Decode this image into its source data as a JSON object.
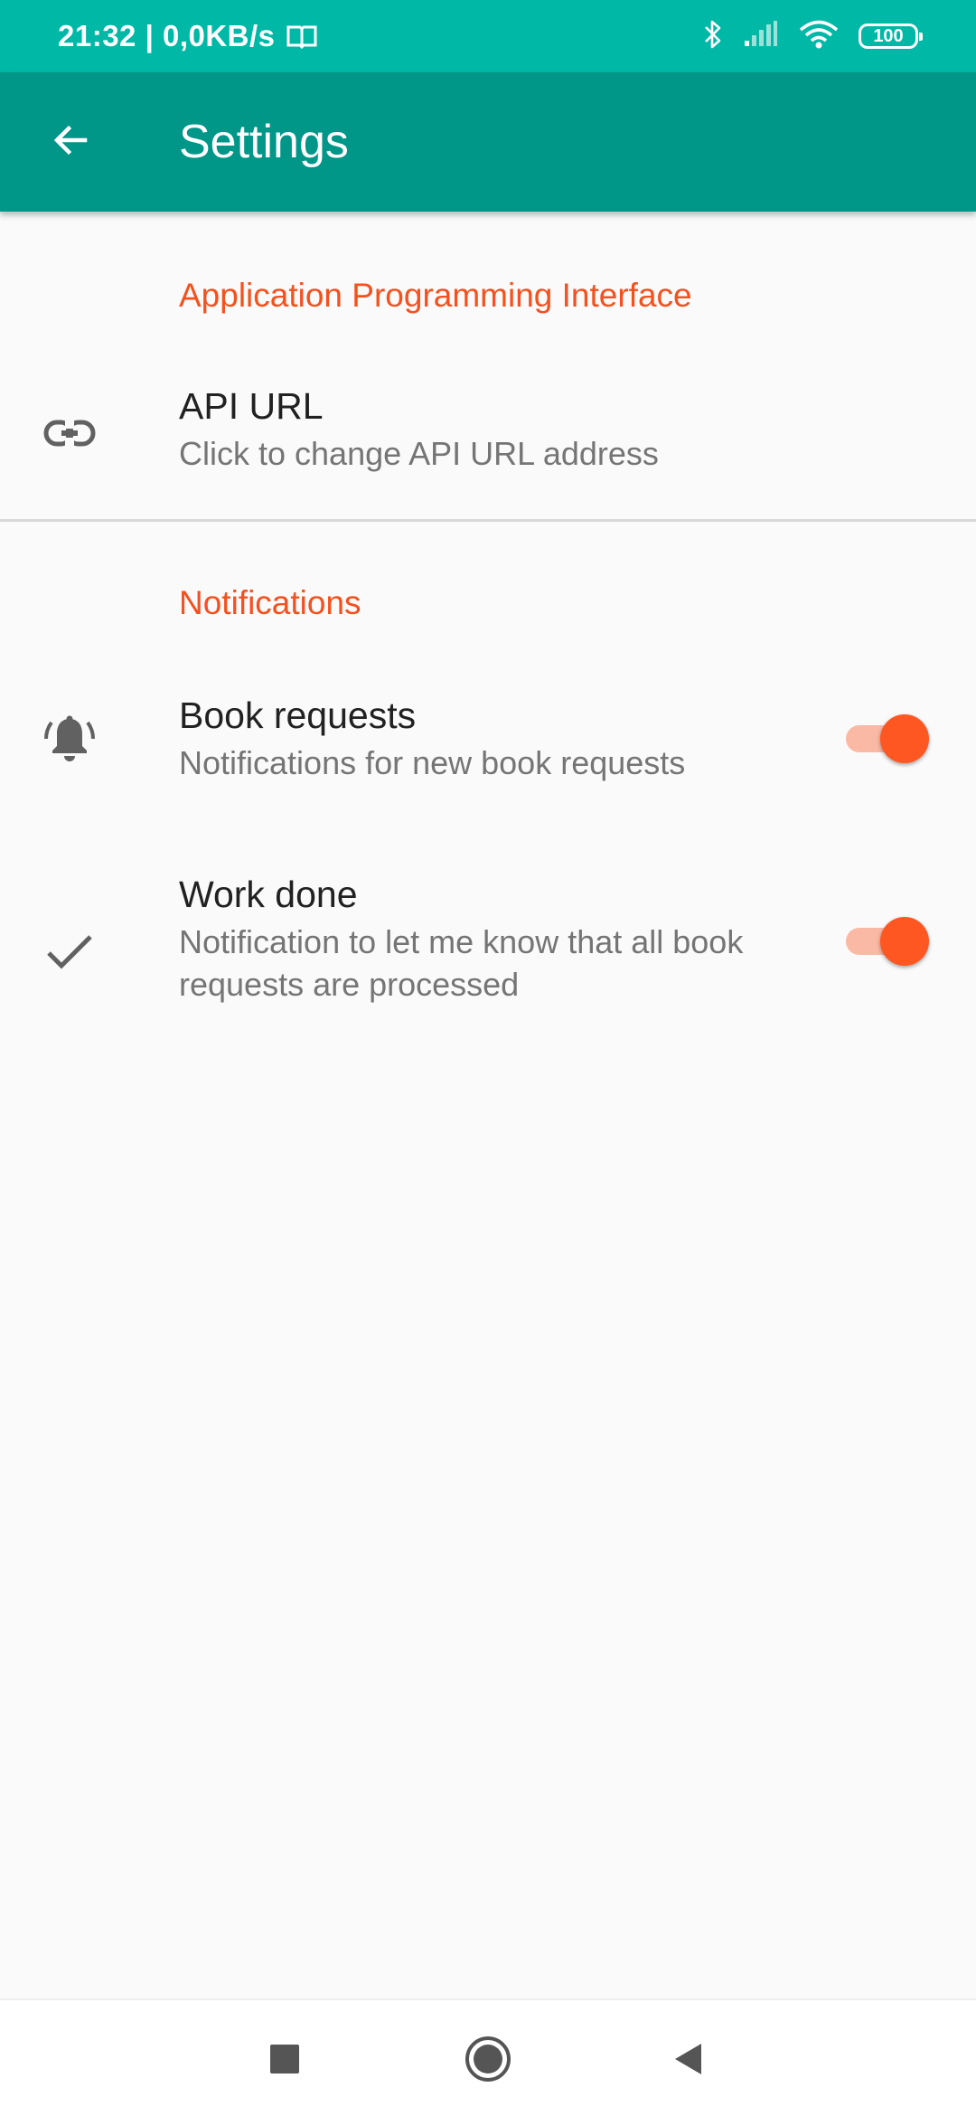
{
  "status_bar": {
    "time_and_speed": "21:32 | 0,0KB/s",
    "battery_level": "100",
    "icons": [
      "book-icon",
      "bluetooth-icon",
      "signal-icon",
      "wifi-icon",
      "battery-icon"
    ]
  },
  "app_bar": {
    "title": "Settings",
    "back_icon": "arrow-back-icon"
  },
  "sections": {
    "api": {
      "header": "Application Programming Interface",
      "items": [
        {
          "icon": "link-icon",
          "title": "API URL",
          "summary": "Click to change API URL address"
        }
      ]
    },
    "notifications": {
      "header": "Notifications",
      "items": [
        {
          "icon": "bell-ring-icon",
          "title": "Book requests",
          "summary": "Notifications for new book requests",
          "enabled": true
        },
        {
          "icon": "check-icon",
          "title": "Work done",
          "summary": "Notification to let me know that all book requests are processed",
          "enabled": true
        }
      ]
    }
  },
  "nav_bar": {
    "buttons": [
      "recents-square-icon",
      "home-circle-icon",
      "back-triangle-icon"
    ]
  },
  "colors": {
    "status_bar": "#00b8a6",
    "app_bar": "#009688",
    "accent": "#f4511e",
    "switch_thumb": "#ff5722",
    "switch_track": "#f9b9a5",
    "background": "#fafafa"
  }
}
